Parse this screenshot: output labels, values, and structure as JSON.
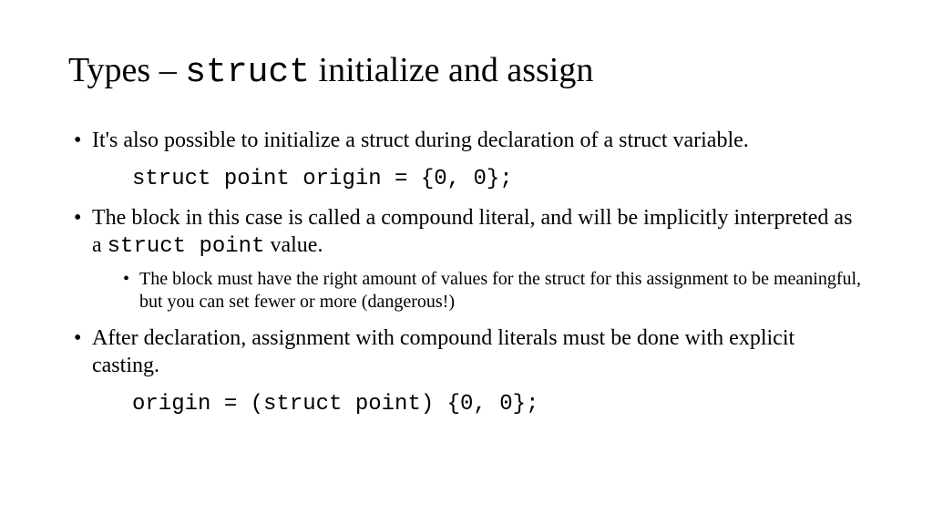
{
  "title": {
    "prefix": "Types",
    "separator": " – ",
    "code": "struct",
    "suffix": " initialize and assign"
  },
  "bullets": [
    {
      "text": "It's also possible to initialize a struct during declaration of a struct variable.",
      "code": "struct point origin = {0, 0};"
    },
    {
      "text_pre": "The block in this case is called a compound literal, and will be implicitly interpreted as a ",
      "text_code": "struct point",
      "text_post": " value.",
      "sub": [
        "The block must have the right amount of values for the struct for this assignment to be meaningful, but you can set fewer or more (dangerous!)"
      ]
    },
    {
      "text": "After declaration, assignment with compound literals must be done with explicit casting.",
      "code": "origin = (struct point) {0, 0};"
    }
  ]
}
